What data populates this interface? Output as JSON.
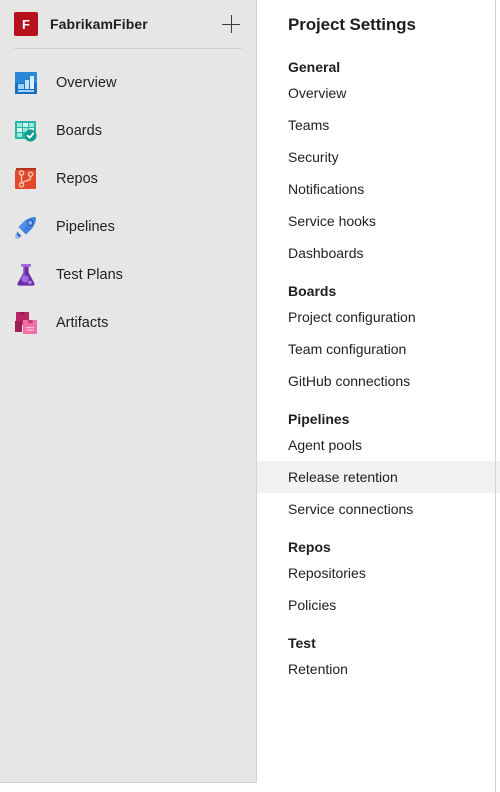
{
  "sidebar": {
    "project": {
      "avatar_initial": "F",
      "name": "FabrikamFiber",
      "new_button_label": "+",
      "new_button_icon": "plus-icon"
    },
    "items": [
      {
        "label": "Overview",
        "icon": "overview-chart-icon",
        "color": "#1976D2"
      },
      {
        "label": "Boards",
        "icon": "boards-grid-check-icon",
        "color": "#22A699"
      },
      {
        "label": "Repos",
        "icon": "repos-branch-icon",
        "color": "#E2492B"
      },
      {
        "label": "Pipelines",
        "icon": "pipelines-rocket-icon",
        "color": "#2E6FD9"
      },
      {
        "label": "Test Plans",
        "icon": "test-plans-flask-icon",
        "color": "#6B2FA8"
      },
      {
        "label": "Artifacts",
        "icon": "artifacts-boxes-icon",
        "color": "#D6337E"
      }
    ]
  },
  "settings": {
    "title": "Project Settings",
    "selected_item": "Release retention",
    "groups": [
      {
        "header": "General",
        "items": [
          "Overview",
          "Teams",
          "Security",
          "Notifications",
          "Service hooks",
          "Dashboards"
        ]
      },
      {
        "header": "Boards",
        "items": [
          "Project configuration",
          "Team configuration",
          "GitHub connections"
        ]
      },
      {
        "header": "Pipelines",
        "items": [
          "Agent pools",
          "Release retention",
          "Service connections"
        ]
      },
      {
        "header": "Repos",
        "items": [
          "Repositories",
          "Policies"
        ]
      },
      {
        "header": "Test",
        "items": [
          "Retention"
        ]
      }
    ]
  },
  "colors": {
    "sidebar_bg": "#E6E6E6",
    "panel_bg": "#FFFFFF",
    "divider": "#D2D2D2",
    "selected_bg": "#F2F2F2",
    "text": "#1F1F1F",
    "avatar_bg": "#B7111D"
  }
}
